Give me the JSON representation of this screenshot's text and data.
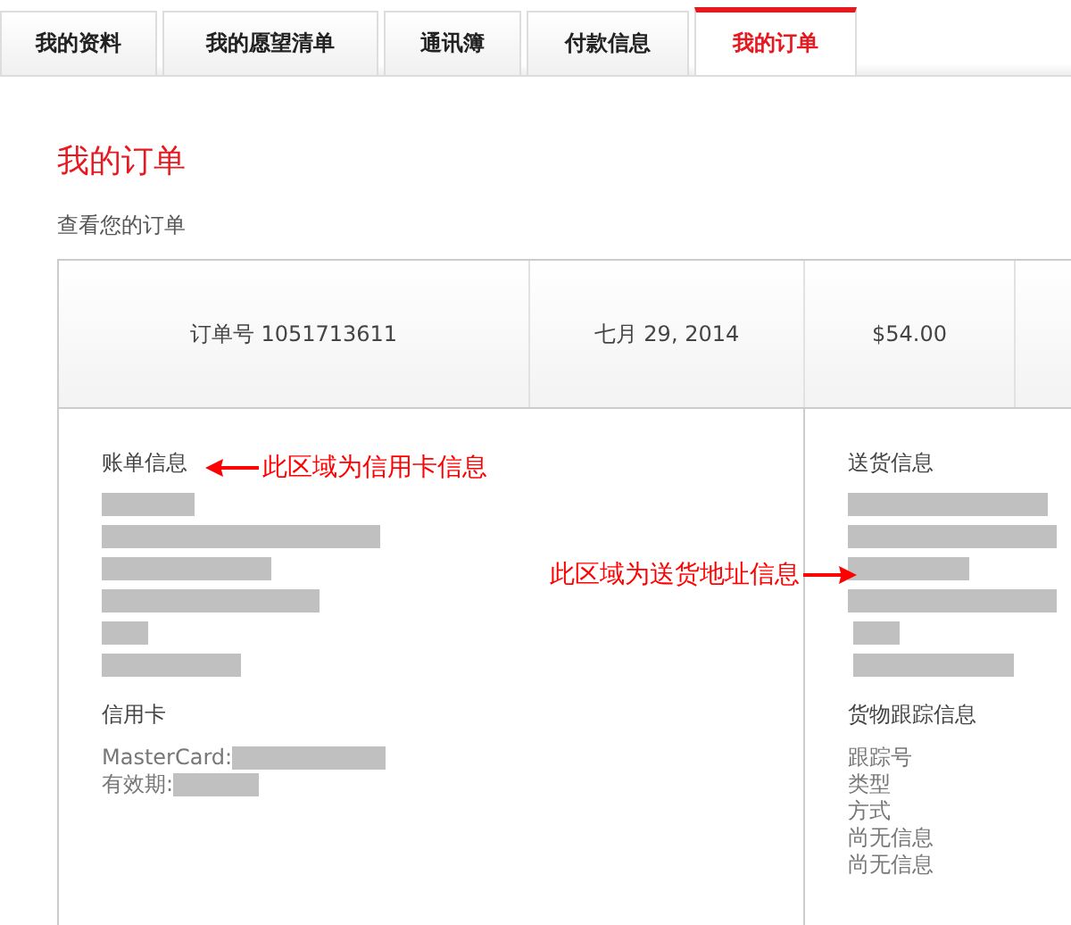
{
  "tabs": [
    {
      "label": "我的资料",
      "selected": false
    },
    {
      "label": "我的愿望清单",
      "selected": false
    },
    {
      "label": "通讯簿",
      "selected": false
    },
    {
      "label": "付款信息",
      "selected": false
    },
    {
      "label": "我的订单",
      "selected": true
    }
  ],
  "heading": "我的订单",
  "subtitle": "查看您的订单",
  "order": {
    "number": "订单号 1051713611",
    "date": "七月 29, 2014",
    "total": "$54.00"
  },
  "billing": {
    "title": "账单信息",
    "lines": [
      {
        "kind": "redacted"
      },
      {
        "kind": "redacted"
      },
      {
        "kind": "redacted"
      },
      {
        "kind": "redacted"
      },
      {
        "kind": "redacted"
      },
      {
        "kind": "redacted"
      }
    ],
    "card_title": "信用卡",
    "card_lines": [
      {
        "label": "MasterCard:"
      },
      {
        "label": "有效期:"
      }
    ]
  },
  "shipping": {
    "title": "送货信息",
    "lines": [
      {
        "kind": "redacted"
      },
      {
        "kind": "redacted"
      },
      {
        "kind": "redacted"
      },
      {
        "kind": "redacted"
      },
      {
        "kind": "redacted"
      },
      {
        "kind": "redacted"
      }
    ],
    "tracking_title": "货物跟踪信息",
    "tracking_lines": [
      "跟踪号",
      "类型",
      "方式",
      "尚无信息",
      "尚无信息"
    ]
  },
  "annotations": [
    {
      "text": "此区域为信用卡信息",
      "kind": "leftarrow"
    },
    {
      "text": "此区域为送货地址信息",
      "kind": "rightarrow"
    }
  ]
}
